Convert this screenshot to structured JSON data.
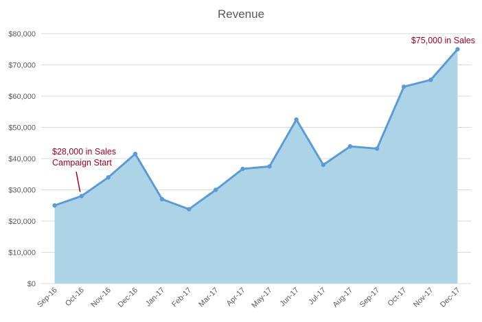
{
  "chart_data": {
    "type": "area",
    "title": "Revenue",
    "xlabel": "",
    "ylabel": "",
    "categories": [
      "Sep-16",
      "Oct-16",
      "Nov-16",
      "Dec-16",
      "Jan-17",
      "Feb-17",
      "Mar-17",
      "Apr-17",
      "May-17",
      "Jun-17",
      "Jul-17",
      "Aug-17",
      "Sep-17",
      "Oct-17",
      "Nov-17",
      "Dec-17"
    ],
    "series": [
      {
        "values": [
          25000,
          28000,
          34000,
          41500,
          27000,
          23800,
          30000,
          36700,
          37500,
          52500,
          38000,
          43900,
          43200,
          63000,
          65200,
          75000
        ]
      }
    ],
    "ylim": [
      0,
      80000
    ],
    "yticks": [
      0,
      10000,
      20000,
      30000,
      40000,
      50000,
      60000,
      70000,
      80000
    ],
    "ytick_labels": [
      "$0",
      "$10,000",
      "$20,000",
      "$30,000",
      "$40,000",
      "$50,000",
      "$60,000",
      "$70,000",
      "$80,000"
    ],
    "grid": true,
    "legend": "none",
    "colors": {
      "line": "#5b9bd5",
      "fill": "#add4e6",
      "annotation": "#a50021",
      "grid": "#d9d9d9",
      "text": "#595959"
    },
    "annotations": [
      {
        "category": "Oct-16",
        "lines": [
          "$28,000 in Sales",
          "Campaign Start"
        ]
      },
      {
        "category": "Dec-17",
        "lines": [
          "$75,000 in Sales"
        ]
      }
    ]
  }
}
